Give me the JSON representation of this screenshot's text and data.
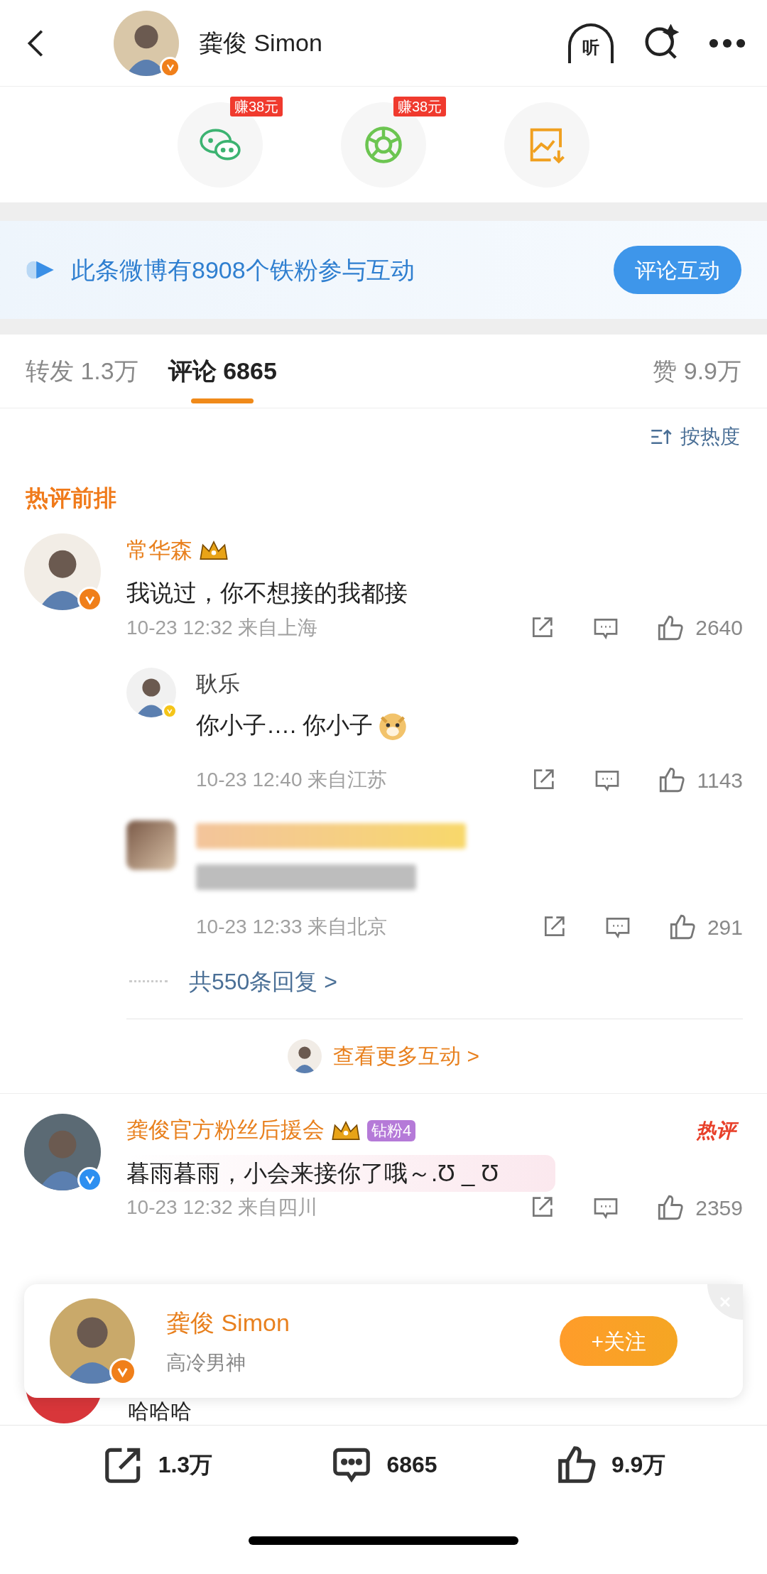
{
  "header": {
    "title": "龚俊 Simon",
    "color": "#f07f1a",
    "listen_label": "听"
  },
  "share_options": [
    {
      "kind": "wechat",
      "badge": "赚38元"
    },
    {
      "kind": "moments",
      "badge": "赚38元"
    },
    {
      "kind": "save-image"
    }
  ],
  "banner": {
    "text": "此条微博有8908个铁粉参与互动",
    "button": "评论互动"
  },
  "tabs": [
    {
      "label": "转发 1.3万",
      "selected": false
    },
    {
      "label": "评论 6865",
      "selected": true
    },
    {
      "label": "赞 9.9万",
      "selected": false
    }
  ],
  "sort": "按热度",
  "section_title": "热评前排",
  "comments": [
    {
      "name": "常华森",
      "color": "#f07f1a",
      "text": "我说过，你不想接的我都接",
      "meta": "10-23 12:32 来自上海",
      "likes": "2640",
      "replies": [
        {
          "name": "耿乐",
          "color": "#f5c518",
          "blurred": false,
          "text": "你小子…. 你小子",
          "meta": "10-23 12:40 来自江苏",
          "likes": "1143"
        },
        {
          "blurred": true,
          "meta": "10-23 12:33 来自北京",
          "likes": "291"
        }
      ],
      "more_replies": "共550条回复 >",
      "more_interactions": "查看更多互动 >"
    },
    {
      "name": "龚俊官方粉丝后援会",
      "fan_badge": "钻粉4",
      "hot_tag": "热评",
      "color": "#2d8ff0",
      "text": "暮雨暮雨，小会来接你了哦～.Ʊ _ Ʊ",
      "meta": "10-23 12:32 来自四川",
      "likes": "2359"
    }
  ],
  "hidden_comment": {
    "text": "哈哈哈"
  },
  "follow_popup": {
    "name": "龚俊 Simon",
    "subtitle": "高冷男神",
    "button": "+关注"
  },
  "bottom_bar": [
    {
      "kind": "repost",
      "count": "1.3万"
    },
    {
      "kind": "comment",
      "count": "6865"
    },
    {
      "kind": "like",
      "count": "9.9万"
    }
  ]
}
